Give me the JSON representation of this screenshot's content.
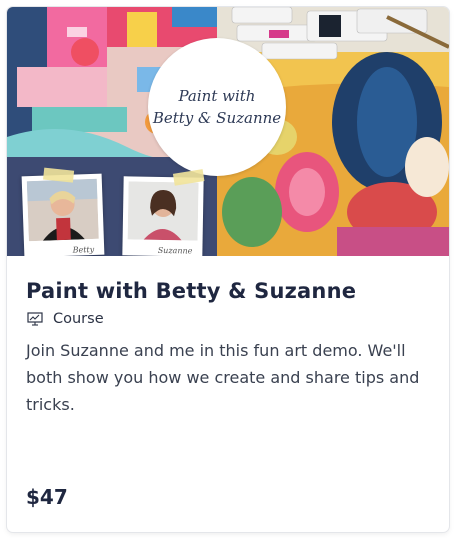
{
  "card": {
    "hero": {
      "badge_line1": "Paint with",
      "badge_line2": "Betty & Suzanne",
      "photo_left_signature": "Betty",
      "photo_right_signature": "Suzanne"
    },
    "title": "Paint with Betty & Suzanne",
    "type_icon": "presentation-board-icon",
    "type_label": "Course",
    "description": "Join Suzanne and me in this fun art demo. We'll both show you how we create and share tips and tricks.",
    "price": "$47"
  },
  "colors": {
    "title": "#1f2740",
    "body_text": "#3a4150",
    "photo_panel": "#3d4a72",
    "card_border": "#e4e6ea"
  }
}
